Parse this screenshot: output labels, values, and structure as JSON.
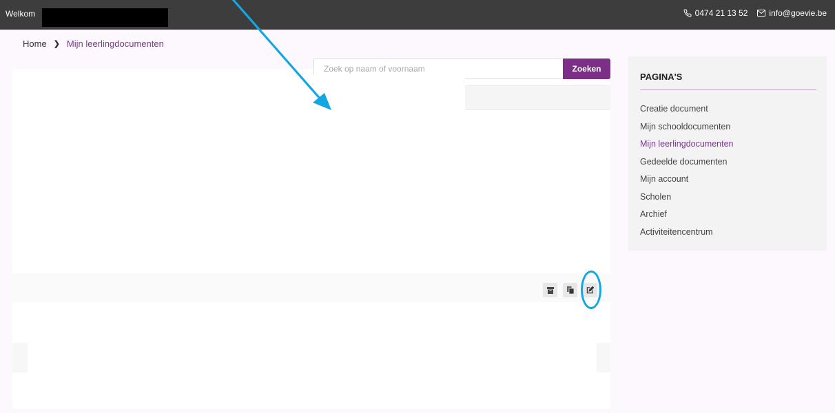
{
  "topbar": {
    "welcome": "Welkom",
    "phone": "0474 21 13 52",
    "email": "info@goevie.be",
    "phone_icon": "phone-icon",
    "mail_icon": "mail-icon"
  },
  "breadcrumb": {
    "home": "Home",
    "current": "Mijn leerlingdocumenten"
  },
  "search": {
    "placeholder": "Zoek op naam of voornaam",
    "button": "Zoeken"
  },
  "row_actions": {
    "icons": [
      "archive-icon",
      "copy-icon",
      "edit-icon"
    ]
  },
  "sidebar": {
    "title": "PAGINA'S",
    "items": [
      "Creatie document",
      "Mijn schooldocumenten",
      "Mijn leerlingdocumenten",
      "Gedeelde documenten",
      "Mijn account",
      "Scholen",
      "Archief",
      "Activiteitencentrum"
    ],
    "active_index": 2
  },
  "annotation": {
    "arrow_color": "#12a6e3",
    "ring_color": "#12a6e3"
  },
  "colors": {
    "brand": "#7b2f86",
    "topbar": "#3d3d3d"
  }
}
